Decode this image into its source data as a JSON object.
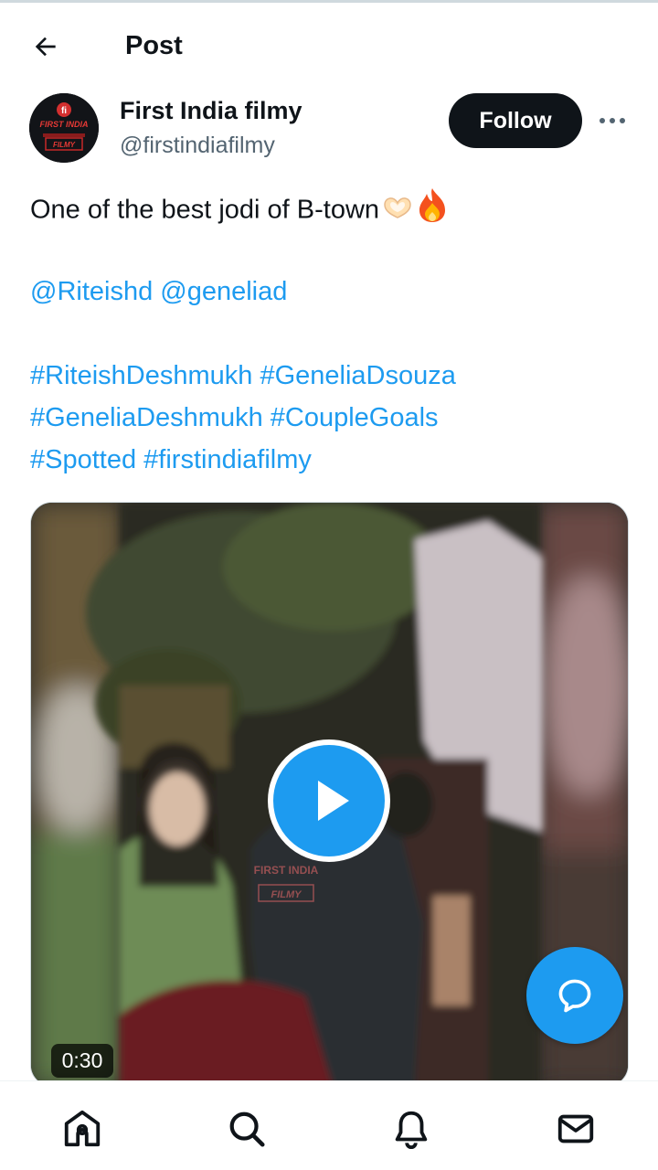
{
  "header": {
    "title": "Post",
    "back_icon": "arrow-left-icon"
  },
  "author": {
    "display_name": "First India filmy",
    "handle": "@firstindiafilmy",
    "avatar_lines": [
      "FIRST INDIA",
      "FILMY"
    ],
    "follow_label": "Follow",
    "more_icon": "more-horizontal-icon"
  },
  "post": {
    "text": "One of the best jodi of B-town",
    "emojis": [
      "heart-hands-icon",
      "fire-icon"
    ],
    "mentions": "@Riteishd @geneliad",
    "hashtags_line1": "#RiteishDeshmukh #GeneliaDsouza",
    "hashtags_line2": "#GeneliaDeshmukh #CoupleGoals",
    "hashtags_line3": "#Spotted #firstindiafilmy"
  },
  "media": {
    "duration": "0:30",
    "watermark_lines": [
      "FIRST INDIA",
      "FILMY"
    ],
    "play_icon": "play-icon"
  },
  "fab": {
    "icon": "reply-icon"
  },
  "bottom_nav": {
    "items": [
      "home-icon",
      "search-icon",
      "notifications-icon",
      "messages-icon"
    ]
  },
  "colors": {
    "accent": "#1d9bf0",
    "text": "#0f1419",
    "secondary": "#536471",
    "follow_bg": "#0f1419"
  }
}
